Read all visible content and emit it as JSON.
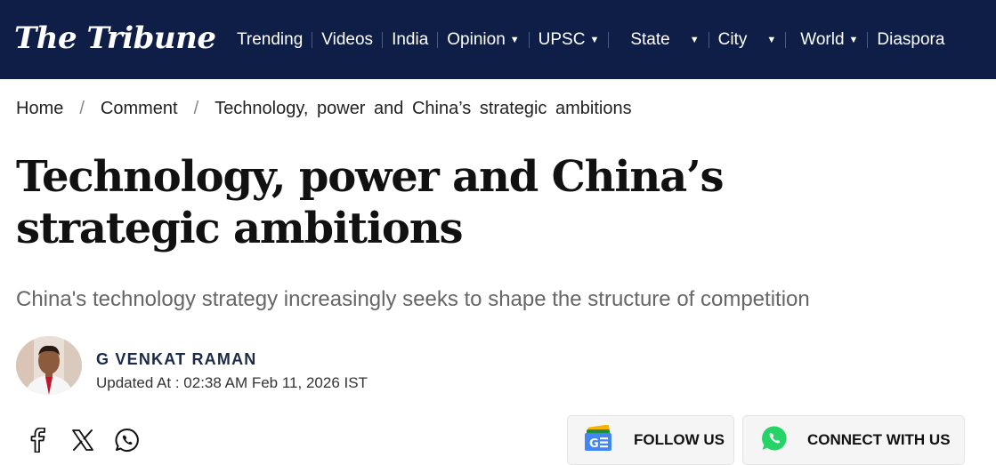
{
  "site": {
    "logo_text": "The Tribune"
  },
  "nav": {
    "items": [
      {
        "label": "Trending"
      },
      {
        "label": "Videos"
      },
      {
        "label": "India"
      },
      {
        "label": "Opinion"
      },
      {
        "label": "UPSC"
      },
      {
        "label": "State"
      },
      {
        "label": "City"
      },
      {
        "label": "World"
      },
      {
        "label": "Diaspora"
      }
    ]
  },
  "breadcrumb": {
    "home": "Home",
    "section": "Comment",
    "current": "Technology, power and China’s strategic ambitions",
    "separator": "/"
  },
  "article": {
    "title": "Technology, power and China’s strategic ambitions",
    "subtitle": "China's technology strategy increasingly seeks to shape the structure of competition",
    "author": "G VENKAT RAMAN",
    "updated": "Updated At : 02:38 AM Feb 11, 2026 IST"
  },
  "share": {
    "icons": [
      "facebook-icon",
      "x-icon",
      "whatsapp-icon"
    ]
  },
  "actions": {
    "follow_label": "FOLLOW US",
    "connect_label": "CONNECT WITH US"
  },
  "colors": {
    "header_bg": "#0f1e46",
    "whatsapp_green": "#25d366",
    "author_name": "#1b2a4a"
  }
}
